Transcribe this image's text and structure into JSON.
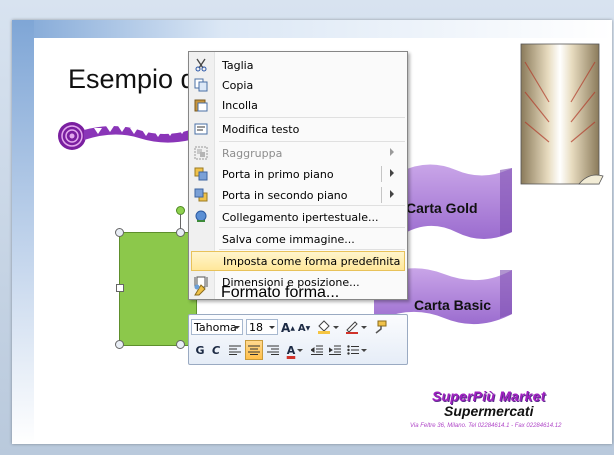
{
  "slide": {
    "title": "Esempio d",
    "ribbon_gold": "Carta Gold",
    "ribbon_basic": "Carta Basic",
    "market_name": "SuperPiù Market",
    "market_sub": "Supermercati",
    "market_address": "Via Feltre 36, Milano. Tel 02284614.1  - Fax 02284614.12"
  },
  "context_menu": {
    "items": [
      {
        "label": "Taglia",
        "icon": "scissors-icon",
        "enabled": true
      },
      {
        "label": "Copia",
        "icon": "copy-icon",
        "enabled": true
      },
      {
        "label": "Incolla",
        "icon": "paste-icon",
        "enabled": true
      },
      {
        "label": "Modifica testo",
        "icon": "edit-text-icon",
        "enabled": true
      },
      {
        "label": "Raggruppa",
        "icon": "group-icon",
        "enabled": false
      },
      {
        "label": "Porta in primo piano",
        "icon": "bring-forward-icon",
        "enabled": true
      },
      {
        "label": "Porta in secondo piano",
        "icon": "send-backward-icon",
        "enabled": true
      },
      {
        "label": "Collegamento ipertestuale...",
        "icon": "hyperlink-icon",
        "enabled": true
      },
      {
        "label": "Salva come immagine...",
        "icon": "",
        "enabled": true
      },
      {
        "label": "Imposta come forma predefinita",
        "icon": "",
        "enabled": true,
        "highlighted": true
      },
      {
        "label": "Dimensioni e posizione...",
        "icon": "size-position-icon",
        "enabled": true
      },
      {
        "label": "Formato forma...",
        "icon": "format-shape-icon",
        "enabled": true
      }
    ]
  },
  "mini_toolbar": {
    "font_name": "Tahoma",
    "font_size": "18",
    "bold": "G",
    "italic": "C",
    "colors": {
      "highlight_fill": "#f5c542",
      "font_color": "#d0322a",
      "accent": "#ffbf4a"
    }
  }
}
